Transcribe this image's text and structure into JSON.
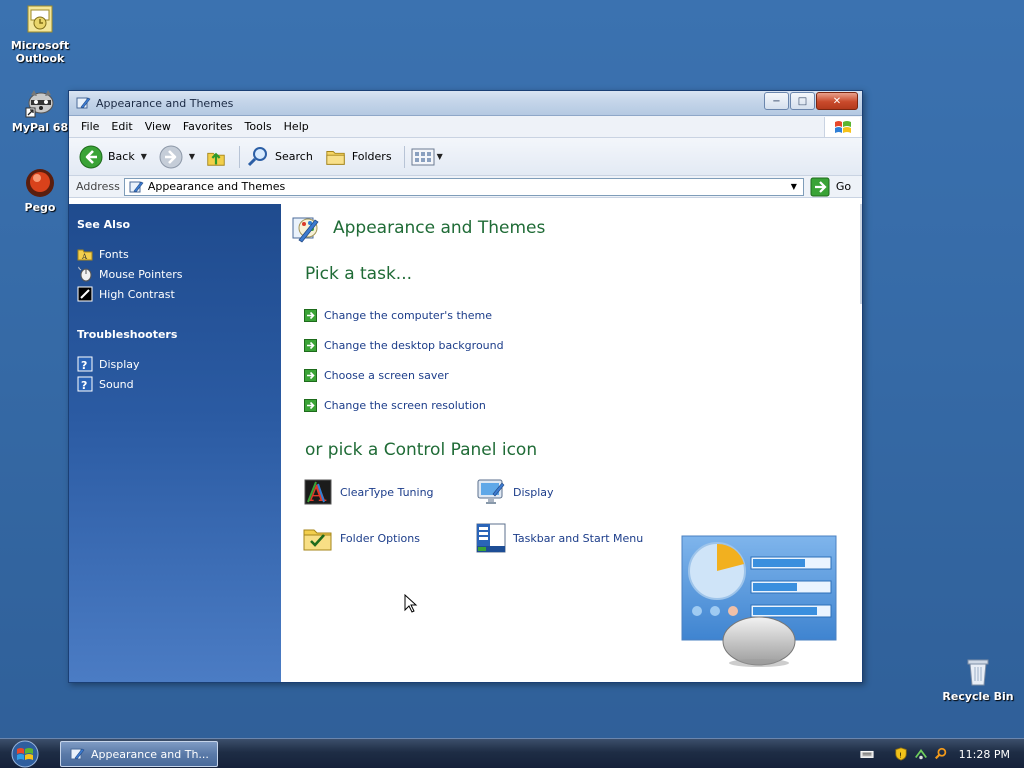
{
  "desktop": {
    "icons": [
      {
        "label_line1": "Microsoft",
        "label_line2": "Outlook"
      },
      {
        "label": "MyPal 68"
      },
      {
        "label": "Pego"
      }
    ],
    "recycle_bin": "Recycle Bin"
  },
  "window": {
    "title": "Appearance and Themes",
    "buttons": {
      "minimize": "−",
      "maximize": "□",
      "close": "✕"
    },
    "menu": [
      "File",
      "Edit",
      "View",
      "Favorites",
      "Tools",
      "Help"
    ],
    "toolbar": {
      "back": "Back",
      "search": "Search",
      "folders": "Folders"
    },
    "address": {
      "label": "Address",
      "value": "Appearance and Themes",
      "go": "Go"
    }
  },
  "sidebar": {
    "see_also": {
      "title": "See Also",
      "items": [
        "Fonts",
        "Mouse Pointers",
        "High Contrast"
      ]
    },
    "troubleshooters": {
      "title": "Troubleshooters",
      "items": [
        "Display",
        "Sound"
      ]
    }
  },
  "main": {
    "title": "Appearance and Themes",
    "task_heading": "Pick a task...",
    "tasks": [
      "Change the computer's theme",
      "Change the desktop background",
      "Choose a screen saver",
      "Change the screen resolution"
    ],
    "icon_heading": "or pick a Control Panel icon",
    "icons": [
      "ClearType Tuning",
      "Display",
      "Folder Options",
      "Taskbar and Start Menu"
    ]
  },
  "taskbar": {
    "task_button": "Appearance and Th...",
    "clock": "11:28 PM"
  },
  "colors": {
    "desktop": "#3569a5",
    "sidebar_top": "#1f4b8e",
    "heading_green": "#1f6b36",
    "link_blue": "#1c3d8a"
  }
}
